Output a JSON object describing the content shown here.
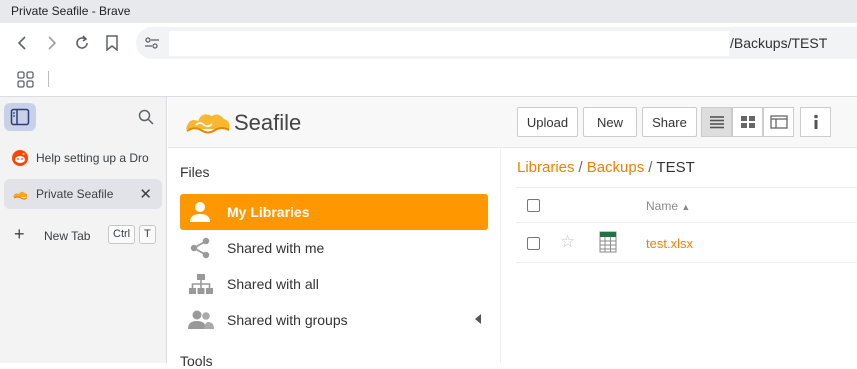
{
  "window": {
    "title": "Private Seafile - Brave"
  },
  "address_bar": {
    "url_suffix": "/Backups/TEST"
  },
  "sidebar": {
    "tabs": [
      {
        "label": "Help setting up a Dro",
        "icon": "reddit-icon"
      },
      {
        "label": "Private Seafile",
        "icon": "seafile-icon",
        "active": true,
        "close": "✕"
      }
    ],
    "new_tab": {
      "label": "New Tab",
      "shortcut_ctrl": "Ctrl",
      "shortcut_key": "T"
    }
  },
  "app": {
    "logo_text": "Seafile",
    "toolbar": {
      "upload": "Upload",
      "new": "New",
      "share": "Share"
    },
    "nav": {
      "heading": "Files",
      "items": [
        {
          "label": "My Libraries",
          "icon": "user-icon",
          "active": true
        },
        {
          "label": "Shared with me",
          "icon": "share-icon"
        },
        {
          "label": "Shared with all",
          "icon": "org-chart-icon"
        },
        {
          "label": "Shared with groups",
          "icon": "group-icon"
        }
      ],
      "heading2": "Tools"
    },
    "breadcrumb": {
      "items": [
        "Libraries",
        "Backups"
      ],
      "current": "TEST",
      "separator": "/"
    },
    "table": {
      "name_header": "Name",
      "sort_indicator": "▲",
      "rows": [
        {
          "name": "test.xlsx",
          "icon": "spreadsheet-icon",
          "starred": false
        }
      ]
    }
  },
  "colors": {
    "accent": "#ff9800",
    "link": "#eb8205",
    "sidebar_toggle": "#c9d1e9"
  }
}
